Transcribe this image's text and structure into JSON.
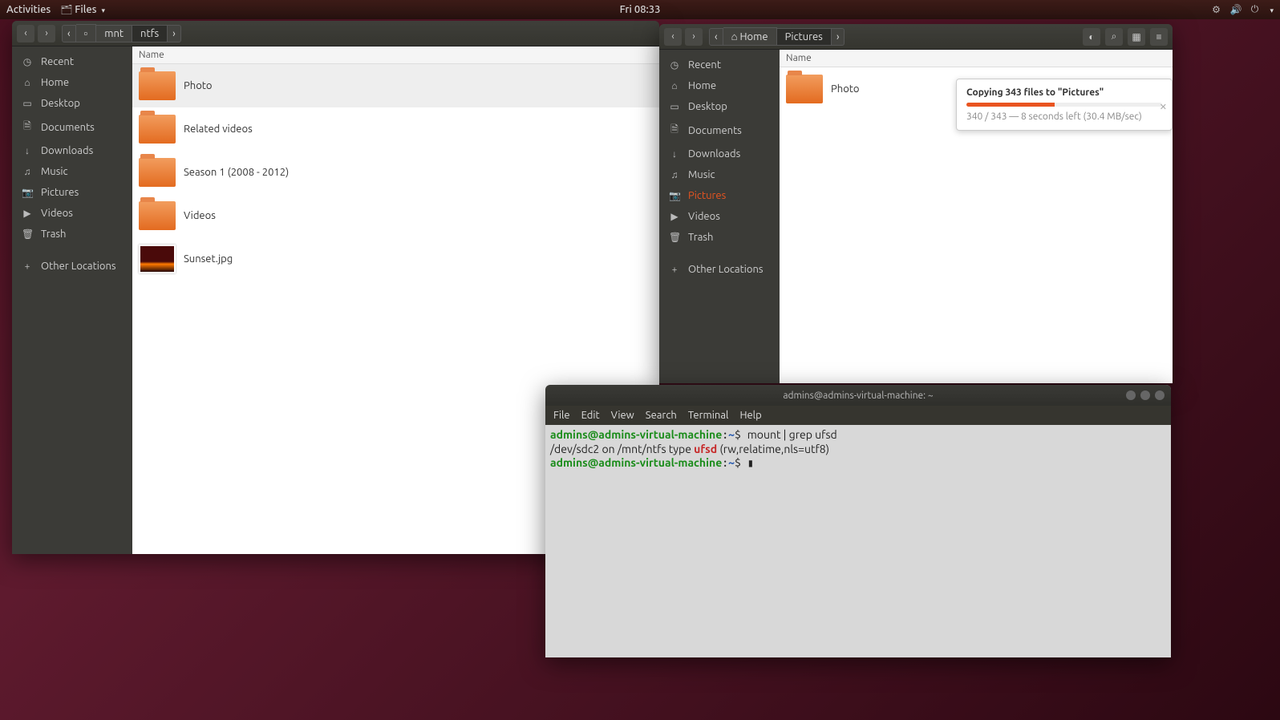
{
  "topbar": {
    "activities": "Activities",
    "app_label": "Files",
    "clock": "Fri 08:33"
  },
  "win1": {
    "path": [
      "mnt",
      "ntfs"
    ],
    "col_name": "Name",
    "sidebar": [
      {
        "icon": "◷",
        "label": "Recent"
      },
      {
        "icon": "⌂",
        "label": "Home"
      },
      {
        "icon": "▭",
        "label": "Desktop"
      },
      {
        "icon": "🗎",
        "label": "Documents"
      },
      {
        "icon": "↓",
        "label": "Downloads"
      },
      {
        "icon": "♫",
        "label": "Music"
      },
      {
        "icon": "📷",
        "label": "Pictures"
      },
      {
        "icon": "▶",
        "label": "Videos"
      },
      {
        "icon": "🗑",
        "label": "Trash"
      }
    ],
    "other_locations": "Other Locations",
    "items": [
      {
        "type": "folder",
        "label": "Photo",
        "selected": true
      },
      {
        "type": "folder",
        "label": "Related videos"
      },
      {
        "type": "folder",
        "label": "Season 1 (2008 - 2012)"
      },
      {
        "type": "folder",
        "label": "Videos"
      },
      {
        "type": "image",
        "label": "Sunset.jpg"
      }
    ]
  },
  "win2": {
    "home_label": "Home",
    "path_active": "Pictures",
    "col_name": "Name",
    "sidebar": [
      {
        "icon": "◷",
        "label": "Recent"
      },
      {
        "icon": "⌂",
        "label": "Home"
      },
      {
        "icon": "▭",
        "label": "Desktop"
      },
      {
        "icon": "🗎",
        "label": "Documents"
      },
      {
        "icon": "↓",
        "label": "Downloads"
      },
      {
        "icon": "♫",
        "label": "Music"
      },
      {
        "icon": "📷",
        "label": "Pictures",
        "active": true
      },
      {
        "icon": "▶",
        "label": "Videos"
      },
      {
        "icon": "🗑",
        "label": "Trash"
      }
    ],
    "other_locations": "Other Locations",
    "items": [
      {
        "type": "folder",
        "label": "Photo"
      }
    ],
    "copy": {
      "title": "Copying 343 files to \"Pictures\"",
      "progress_pct": 45,
      "subtitle": "340 / 343 — 8 seconds left (30.4 MB/sec)"
    }
  },
  "terminal": {
    "title": "admins@admins-virtual-machine: ~",
    "menu": [
      "File",
      "Edit",
      "View",
      "Search",
      "Terminal",
      "Help"
    ],
    "prompt_user": "admins@admins-virtual-machine",
    "prompt_path": "~",
    "cmd1": "mount | grep ufsd",
    "out_pre": "/dev/sdc2 on /mnt/ntfs type ",
    "out_red": "ufsd",
    "out_post": " (rw,relatime,nls=utf8)"
  }
}
